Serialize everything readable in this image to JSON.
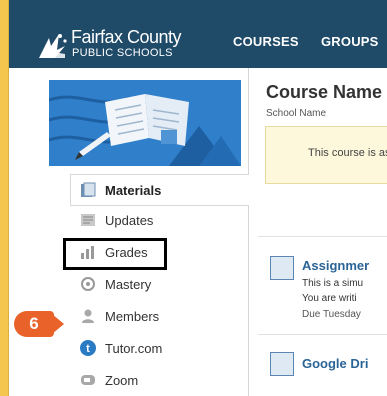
{
  "header": {
    "logo_line1": "Fairfax County",
    "logo_line2": "PUBLIC SCHOOLS",
    "nav": [
      "COURSES",
      "GROUPS"
    ]
  },
  "sidebar": {
    "items": [
      {
        "label": "Materials",
        "icon": "materials-icon",
        "active": true
      },
      {
        "label": "Updates",
        "icon": "updates-icon"
      },
      {
        "label": "Grades",
        "icon": "grades-icon"
      },
      {
        "label": "Mastery",
        "icon": "mastery-icon"
      },
      {
        "label": "Members",
        "icon": "members-icon"
      },
      {
        "label": "Tutor.com",
        "icon": "tutor-icon"
      },
      {
        "label": "Zoom",
        "icon": "zoom-icon"
      }
    ],
    "callout_number": "6"
  },
  "main": {
    "course_name": "Course Name",
    "school_name": "School Name",
    "notice_text": "This course is as",
    "items": [
      {
        "title": "Assignmer",
        "line1": "This is a simu",
        "line2": "You are writi",
        "due": "Due Tuesday"
      },
      {
        "title": "Google Dri"
      }
    ]
  },
  "colors": {
    "header_bg": "#1f4a68",
    "page_bg": "#f4c64e",
    "callout": "#e8622a",
    "link": "#2b6496"
  }
}
